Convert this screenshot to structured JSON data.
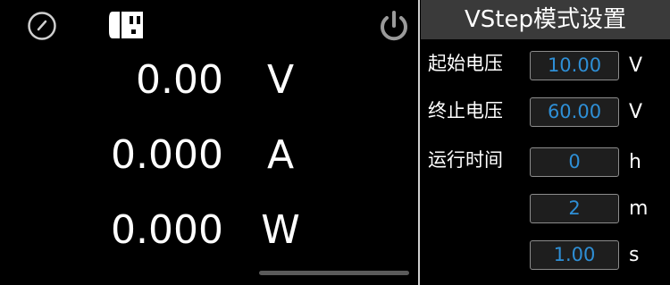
{
  "status_icons": {
    "gauge": "gauge-icon",
    "device": "device-icon",
    "power": "power-icon"
  },
  "readings": {
    "voltage": {
      "value": "0.00",
      "unit": "V"
    },
    "current": {
      "value": "0.000",
      "unit": "A"
    },
    "power": {
      "value": "0.000",
      "unit": "W"
    }
  },
  "settings_panel": {
    "title": "VStep模式设置",
    "start_voltage": {
      "label": "起始电压",
      "value": "10.00",
      "unit": "V"
    },
    "end_voltage": {
      "label": "终止电压",
      "value": "60.00",
      "unit": "V"
    },
    "run_time": {
      "label": "运行时间",
      "hours": {
        "value": "0",
        "unit": "h"
      },
      "minutes": {
        "value": "2",
        "unit": "m"
      },
      "seconds": {
        "value": "1.00",
        "unit": "s"
      }
    }
  },
  "colors": {
    "background": "#000000",
    "header_bg": "#3a3a3a",
    "field_value": "#2e8fd6",
    "icon_gray": "#9a9a9a"
  }
}
